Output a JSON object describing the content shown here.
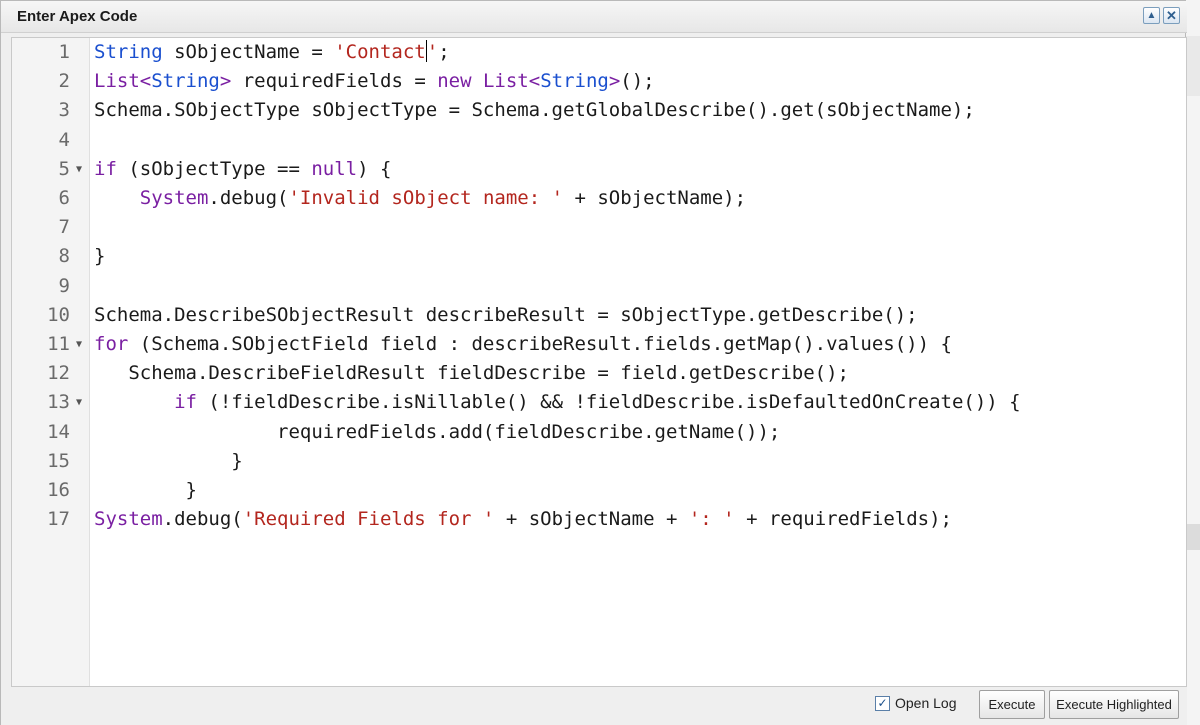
{
  "dialog": {
    "title": "Enter Apex Code"
  },
  "window_buttons": {
    "collapse_icon": "chevron-up-icon",
    "close_icon": "close-icon",
    "collapse_glyph": "▲",
    "close_glyph": "✕"
  },
  "editor": {
    "lines": [
      {
        "num": "1",
        "fold": "",
        "tokens": [
          {
            "t": "String",
            "c": "ty"
          },
          {
            "t": " sObjectName = ",
            "c": ""
          },
          {
            "t": "'Contact",
            "c": "str"
          },
          {
            "t": "",
            "c": "cursor"
          },
          {
            "t": "'",
            "c": "str"
          },
          {
            "t": ";",
            "c": ""
          }
        ]
      },
      {
        "num": "2",
        "fold": "",
        "tokens": [
          {
            "t": "List<",
            "c": "kw"
          },
          {
            "t": "String",
            "c": "ty"
          },
          {
            "t": ">",
            "c": "kw"
          },
          {
            "t": " requiredFields = ",
            "c": ""
          },
          {
            "t": "new",
            "c": "kw"
          },
          {
            "t": " ",
            "c": ""
          },
          {
            "t": "List<",
            "c": "kw"
          },
          {
            "t": "String",
            "c": "ty"
          },
          {
            "t": ">",
            "c": "kw"
          },
          {
            "t": "();",
            "c": ""
          }
        ]
      },
      {
        "num": "3",
        "fold": "",
        "tokens": [
          {
            "t": "Schema.SObjectType sObjectType = Schema.getGlobalDescribe().get(sObjectName);",
            "c": ""
          }
        ]
      },
      {
        "num": "4",
        "fold": "",
        "tokens": []
      },
      {
        "num": "5",
        "fold": "▼",
        "tokens": [
          {
            "t": "if",
            "c": "kw"
          },
          {
            "t": " (sObjectType == ",
            "c": ""
          },
          {
            "t": "null",
            "c": "kw"
          },
          {
            "t": ") {",
            "c": ""
          }
        ]
      },
      {
        "num": "6",
        "fold": "",
        "tokens": [
          {
            "t": "    ",
            "c": ""
          },
          {
            "t": "System",
            "c": "kw"
          },
          {
            "t": ".debug(",
            "c": ""
          },
          {
            "t": "'Invalid sObject name: '",
            "c": "str"
          },
          {
            "t": " + sObjectName);",
            "c": ""
          }
        ]
      },
      {
        "num": "7",
        "fold": "",
        "tokens": []
      },
      {
        "num": "8",
        "fold": "",
        "tokens": [
          {
            "t": "}",
            "c": ""
          }
        ]
      },
      {
        "num": "9",
        "fold": "",
        "tokens": []
      },
      {
        "num": "10",
        "fold": "",
        "tokens": [
          {
            "t": "Schema.DescribeSObjectResult describeResult = sObjectType.getDescribe();",
            "c": ""
          }
        ]
      },
      {
        "num": "11",
        "fold": "▼",
        "tokens": [
          {
            "t": "for",
            "c": "kw"
          },
          {
            "t": " (Schema.SObjectField field : describeResult.fields.getMap().values()) {",
            "c": ""
          }
        ]
      },
      {
        "num": "12",
        "fold": "",
        "tokens": [
          {
            "t": "   Schema.DescribeFieldResult fieldDescribe = field.getDescribe();",
            "c": ""
          }
        ]
      },
      {
        "num": "13",
        "fold": "▼",
        "tokens": [
          {
            "t": "       ",
            "c": ""
          },
          {
            "t": "if",
            "c": "kw"
          },
          {
            "t": " (!fieldDescribe.isNillable() && !fieldDescribe.isDefaultedOnCreate()) {",
            "c": ""
          }
        ]
      },
      {
        "num": "14",
        "fold": "",
        "tokens": [
          {
            "t": "                requiredFields.add(fieldDescribe.getName());",
            "c": ""
          }
        ]
      },
      {
        "num": "15",
        "fold": "",
        "tokens": [
          {
            "t": "            }",
            "c": ""
          }
        ]
      },
      {
        "num": "16",
        "fold": "",
        "tokens": [
          {
            "t": "        }",
            "c": ""
          }
        ]
      },
      {
        "num": "17",
        "fold": "",
        "tokens": [
          {
            "t": "System",
            "c": "kw"
          },
          {
            "t": ".debug(",
            "c": ""
          },
          {
            "t": "'Required Fields for '",
            "c": "str"
          },
          {
            "t": " + sObjectName + ",
            "c": ""
          },
          {
            "t": "': '",
            "c": "str"
          },
          {
            "t": " + requiredFields);",
            "c": ""
          }
        ]
      }
    ]
  },
  "footer": {
    "open_log_label": "Open Log",
    "open_log_checked": true,
    "check_glyph": "✓",
    "execute_label": "Execute",
    "execute_highlighted_label": "Execute Highlighted"
  },
  "colors": {
    "keyword": "#7a1fa2",
    "type": "#1a4fcf",
    "string": "#b3261e"
  }
}
